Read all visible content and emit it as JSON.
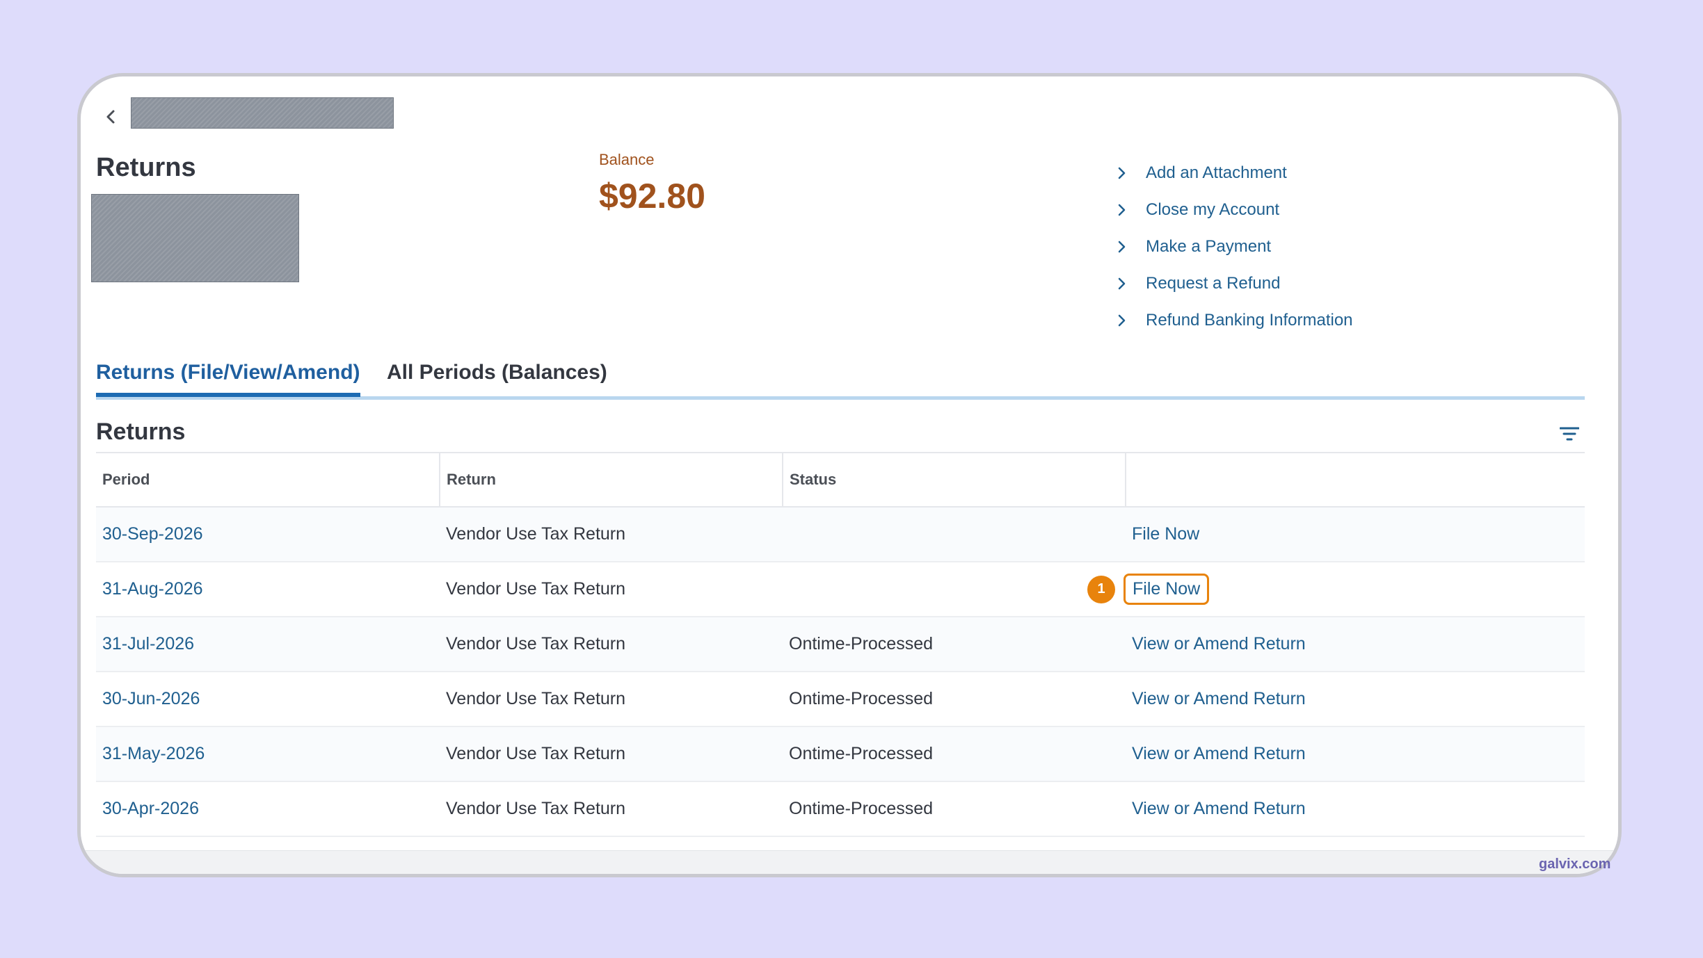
{
  "header": {
    "title": "Returns"
  },
  "balance": {
    "label": "Balance",
    "value": "$92.80",
    "color": "#a0521d"
  },
  "actions": [
    {
      "label": "Add an Attachment"
    },
    {
      "label": "Close my Account"
    },
    {
      "label": "Make a Payment"
    },
    {
      "label": "Request a Refund"
    },
    {
      "label": "Refund Banking Information"
    }
  ],
  "tabs": [
    {
      "label": "Returns (File/View/Amend)",
      "active": true
    },
    {
      "label": "All Periods (Balances)",
      "active": false
    }
  ],
  "section": {
    "title": "Returns"
  },
  "table": {
    "columns": [
      "Period",
      "Return",
      "Status",
      ""
    ],
    "rows": [
      {
        "period": "30-Sep-2026",
        "return": "Vendor Use Tax Return",
        "status": "",
        "action": "File Now"
      },
      {
        "period": "31-Aug-2026",
        "return": "Vendor Use Tax Return",
        "status": "",
        "action": "File Now",
        "step": "1"
      },
      {
        "period": "31-Jul-2026",
        "return": "Vendor Use Tax Return",
        "status": "Ontime-Processed",
        "action": "View or Amend Return"
      },
      {
        "period": "30-Jun-2026",
        "return": "Vendor Use Tax Return",
        "status": "Ontime-Processed",
        "action": "View or Amend Return"
      },
      {
        "period": "31-May-2026",
        "return": "Vendor Use Tax Return",
        "status": "Ontime-Processed",
        "action": "View or Amend Return"
      },
      {
        "period": "30-Apr-2026",
        "return": "Vendor Use Tax Return",
        "status": "Ontime-Processed",
        "action": "View or Amend Return"
      }
    ]
  },
  "icons": {
    "back": "chevron-left-icon",
    "action_chevron": "chevron-right-icon",
    "filter": "filter-icon"
  },
  "colors": {
    "link": "#1f5f8f",
    "accent": "#1d6bb3",
    "highlight": "#e8830c"
  },
  "watermark": "galvix.com"
}
